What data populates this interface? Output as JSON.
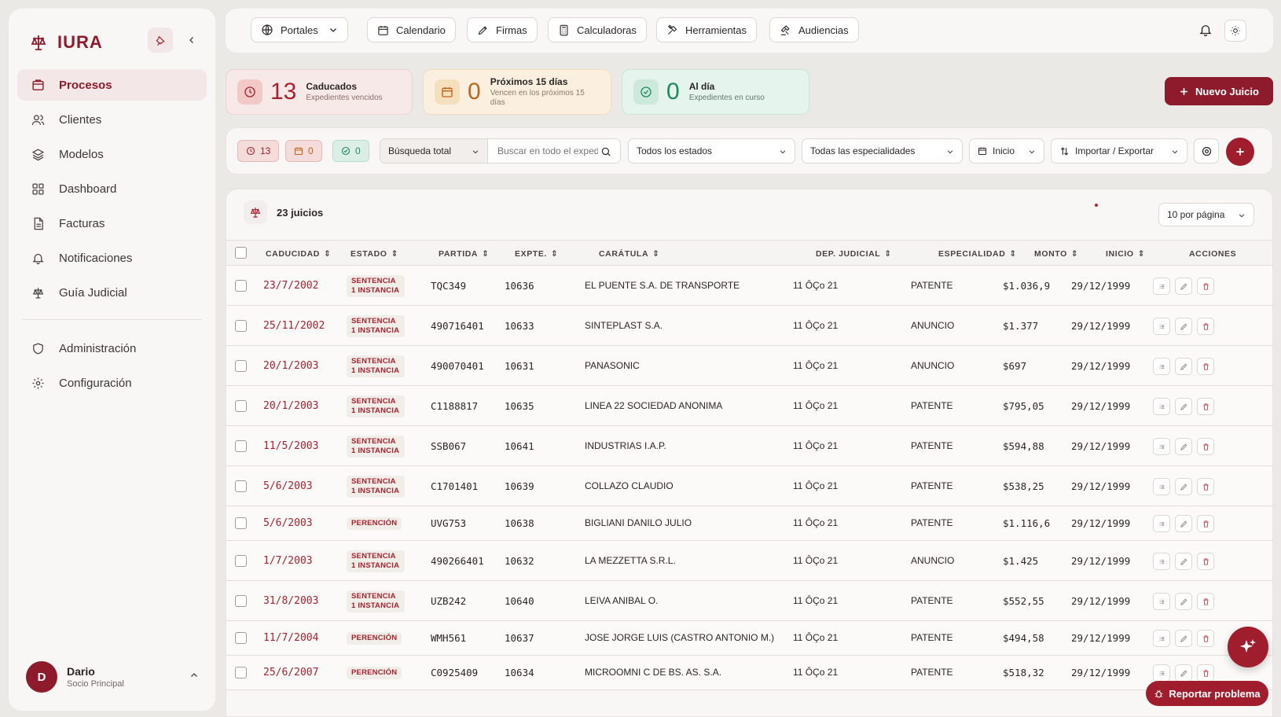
{
  "brand": {
    "name": "IURA",
    "accent": "#8e1b2b"
  },
  "sidebar": {
    "items": [
      {
        "label": "Procesos",
        "icon": "folder-icon",
        "active": true
      },
      {
        "label": "Clientes",
        "icon": "users-icon"
      },
      {
        "label": "Modelos",
        "icon": "layers-icon"
      },
      {
        "label": "Dashboard",
        "icon": "grid-icon"
      },
      {
        "label": "Facturas",
        "icon": "file-icon"
      },
      {
        "label": "Notificaciones",
        "icon": "bell-icon"
      },
      {
        "label": "Guía Judicial",
        "icon": "scale-icon"
      },
      {
        "label": "Administración",
        "icon": "shield-icon"
      },
      {
        "label": "Configuración",
        "icon": "gear-icon"
      }
    ],
    "user": {
      "initial": "D",
      "name": "Dario",
      "role": "Socio Principal"
    }
  },
  "topbar": {
    "buttons": {
      "portales": "Portales",
      "calendario": "Calendario",
      "firmas": "Firmas",
      "calculadoras": "Calculadoras",
      "herramientas": "Herramientas",
      "audiencias": "Audiencias"
    }
  },
  "stats": {
    "caducados": {
      "count": "13",
      "title": "Caducados",
      "subtitle": "Expedientes vencidos"
    },
    "proximos": {
      "count": "0",
      "title": "Próximos 15 días",
      "subtitle": "Vencen en los próximos 15 días"
    },
    "aldia": {
      "count": "0",
      "title": "Al día",
      "subtitle": "Expedientes en curso"
    }
  },
  "new_button": "Nuevo Juicio",
  "filters": {
    "chip_red": "13",
    "chip_orange": "0",
    "chip_green": "0",
    "search_scope": "Búsqueda total",
    "search_placeholder": "Buscar en todo el expediente...",
    "estado": "Todos los estados",
    "especialidad": "Todas las especialidades",
    "inicio": "Inicio",
    "import_export": "Importar / Exportar"
  },
  "table": {
    "count_label": "23 juicios",
    "per_page": "10 por página",
    "columns": [
      "CADUCIDAD",
      "ESTADO",
      "PARTIDA",
      "EXPTE.",
      "CARÁTULA",
      "DEP. JUDICIAL",
      "ESPECIALIDAD",
      "MONTO",
      "INICIO",
      "ACCIONES"
    ],
    "rows": [
      {
        "caducidad": "23/7/2002",
        "estado": "SENTENCIA 1 INSTANCIA",
        "partida": "TQC349",
        "expte": "10636",
        "caratula": "EL PUENTE S.A. DE TRANSPORTE",
        "dep": "11 ÔÇo 21",
        "especialidad": "PATENTE",
        "monto": "$1.036,9",
        "inicio": "29/12/1999"
      },
      {
        "caducidad": "25/11/2002",
        "estado": "SENTENCIA 1 INSTANCIA",
        "partida": "490716401",
        "expte": "10633",
        "caratula": "SINTEPLAST S.A.",
        "dep": "11 ÔÇo 21",
        "especialidad": "ANUNCIO",
        "monto": "$1.377",
        "inicio": "29/12/1999"
      },
      {
        "caducidad": "20/1/2003",
        "estado": "SENTENCIA 1 INSTANCIA",
        "partida": "490070401",
        "expte": "10631",
        "caratula": "PANASONIC",
        "dep": "11 ÔÇo 21",
        "especialidad": "ANUNCIO",
        "monto": "$697",
        "inicio": "29/12/1999"
      },
      {
        "caducidad": "20/1/2003",
        "estado": "SENTENCIA 1 INSTANCIA",
        "partida": "C1188817",
        "expte": "10635",
        "caratula": "LINEA 22 SOCIEDAD ANONIMA",
        "dep": "11 ÔÇo 21",
        "especialidad": "PATENTE",
        "monto": "$795,05",
        "inicio": "29/12/1999"
      },
      {
        "caducidad": "11/5/2003",
        "estado": "SENTENCIA 1 INSTANCIA",
        "partida": "SSB067",
        "expte": "10641",
        "caratula": "INDUSTRIAS I.A.P.",
        "dep": "11 ÔÇo 21",
        "especialidad": "PATENTE",
        "monto": "$594,88",
        "inicio": "29/12/1999"
      },
      {
        "caducidad": "5/6/2003",
        "estado": "SENTENCIA 1 INSTANCIA",
        "partida": "C1701401",
        "expte": "10639",
        "caratula": "COLLAZO CLAUDIO",
        "dep": "11 ÔÇo 21",
        "especialidad": "PATENTE",
        "monto": "$538,25",
        "inicio": "29/12/1999"
      },
      {
        "caducidad": "5/6/2003",
        "estado": "PERENCIÓN",
        "partida": "UVG753",
        "expte": "10638",
        "caratula": "BIGLIANI DANILO JULIO",
        "dep": "11 ÔÇo 21",
        "especialidad": "PATENTE",
        "monto": "$1.116,6",
        "inicio": "29/12/1999"
      },
      {
        "caducidad": "1/7/2003",
        "estado": "SENTENCIA 1 INSTANCIA",
        "partida": "490266401",
        "expte": "10632",
        "caratula": "LA MEZZETTA S.R.L.",
        "dep": "11 ÔÇo 21",
        "especialidad": "ANUNCIO",
        "monto": "$1.425",
        "inicio": "29/12/1999"
      },
      {
        "caducidad": "31/8/2003",
        "estado": "SENTENCIA 1 INSTANCIA",
        "partida": "UZB242",
        "expte": "10640",
        "caratula": "LEIVA ANIBAL O.",
        "dep": "11 ÔÇo 21",
        "especialidad": "PATENTE",
        "monto": "$552,55",
        "inicio": "29/12/1999"
      },
      {
        "caducidad": "11/7/2004",
        "estado": "PERENCIÓN",
        "partida": "WMH561",
        "expte": "10637",
        "caratula": "JOSE JORGE LUIS (CASTRO ANTONIO M.)",
        "dep": "11 ÔÇo 21",
        "especialidad": "PATENTE",
        "monto": "$494,58",
        "inicio": "29/12/1999"
      },
      {
        "caducidad": "25/6/2007",
        "estado": "PERENCIÓN",
        "partida": "C0925409",
        "expte": "10634",
        "caratula": "MICROOMNI C DE BS. AS. S.A.",
        "dep": "11 ÔÇo 21",
        "especialidad": "PATENTE",
        "monto": "$518,32",
        "inicio": "29/12/1999"
      }
    ]
  },
  "report_button": "Reportar problema"
}
